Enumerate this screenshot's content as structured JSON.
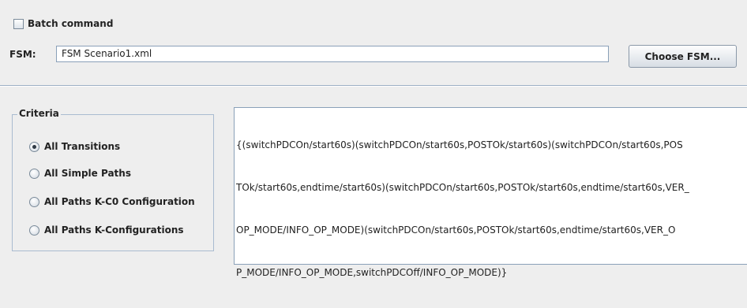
{
  "batch": {
    "label": "Batch command",
    "checked": false
  },
  "fsm": {
    "label": "FSM:",
    "value": "FSM Scenario1.xml",
    "button": "Choose FSM..."
  },
  "criteria": {
    "title": "Criteria",
    "options": [
      {
        "label": "All Transitions",
        "selected": true
      },
      {
        "label": "All Simple Paths",
        "selected": false
      },
      {
        "label": "All Paths K-C0 Configuration",
        "selected": false
      },
      {
        "label": "All Paths K-Configurations",
        "selected": false
      }
    ]
  },
  "output": {
    "lines": [
      "{(switchPDCOn/start60s)(switchPDCOn/start60s,POSTOk/start60s)(switchPDCOn/start60s,POS",
      "TOk/start60s,endtime/start60s)(switchPDCOn/start60s,POSTOk/start60s,endtime/start60s,VER_",
      "OP_MODE/INFO_OP_MODE)(switchPDCOn/start60s,POSTOk/start60s,endtime/start60s,VER_O",
      "P_MODE/INFO_OP_MODE,switchPDCOff/INFO_OP_MODE)}"
    ]
  }
}
